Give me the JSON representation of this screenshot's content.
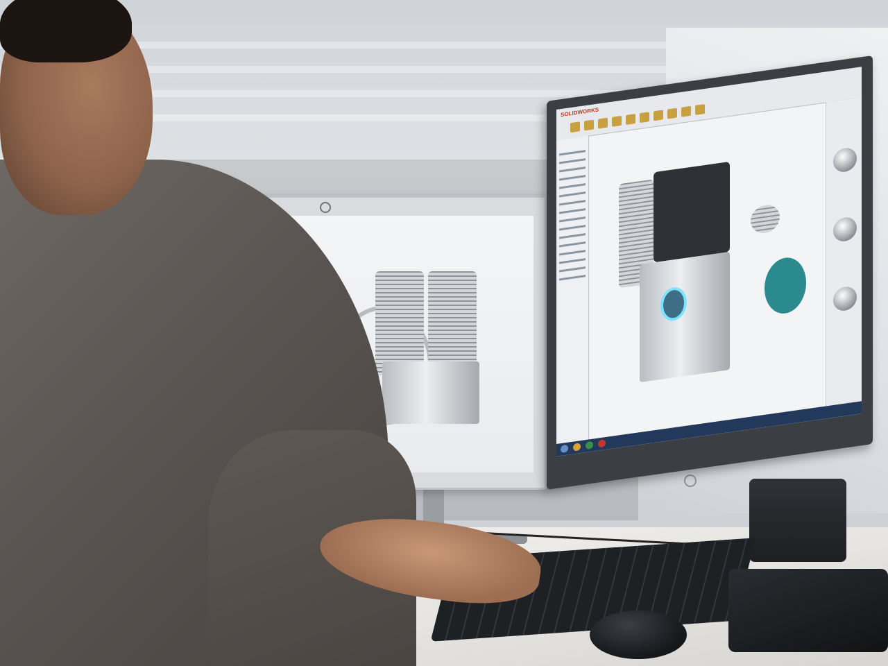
{
  "scene": {
    "description_tags": [
      "office",
      "engineer",
      "dual-monitor",
      "cad-software"
    ],
    "colors": {
      "accent_cyan": "#2b8a8e",
      "metal": "#c8ccd1",
      "taskbar": "#22395b",
      "brand_red": "#c0392b"
    }
  },
  "right_screen": {
    "app_brand": "SOLIDWORKS",
    "icons": [
      "toolbar-icon",
      "feature-tree-icon",
      "taskpane-ball-icon",
      "taskbar-start-icon"
    ]
  }
}
